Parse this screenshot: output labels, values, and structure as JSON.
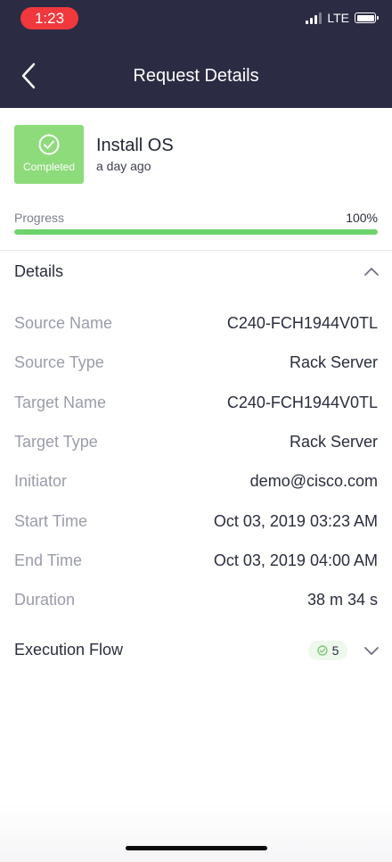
{
  "status_bar": {
    "time": "1:23",
    "network": "LTE"
  },
  "header": {
    "title": "Request Details"
  },
  "request": {
    "status": "Completed",
    "title": "Install OS",
    "relative_time": "a day ago"
  },
  "progress": {
    "label": "Progress",
    "value_text": "100%",
    "fraction": 1.0
  },
  "details": {
    "title": "Details",
    "rows": [
      {
        "label": "Source Name",
        "value": "C240-FCH1944V0TL"
      },
      {
        "label": "Source Type",
        "value": "Rack Server"
      },
      {
        "label": "Target Name",
        "value": "C240-FCH1944V0TL"
      },
      {
        "label": "Target Type",
        "value": "Rack Server"
      },
      {
        "label": "Initiator",
        "value": "demo@cisco.com"
      },
      {
        "label": "Start Time",
        "value": "Oct 03, 2019 03:23 AM"
      },
      {
        "label": "End Time",
        "value": "Oct 03, 2019 04:00 AM"
      },
      {
        "label": "Duration",
        "value": "38 m 34 s"
      }
    ]
  },
  "execution_flow": {
    "title": "Execution Flow",
    "completed_count": "5"
  },
  "colors": {
    "header_bg": "#2b2c43",
    "success": "#8ddb7a",
    "progress": "#6dd36a",
    "status_time_bg": "#f0383d"
  },
  "icons": [
    "back-chevron-icon",
    "check-circle-icon",
    "chevron-up-icon",
    "chevron-down-icon",
    "small-check-circle-icon"
  ]
}
